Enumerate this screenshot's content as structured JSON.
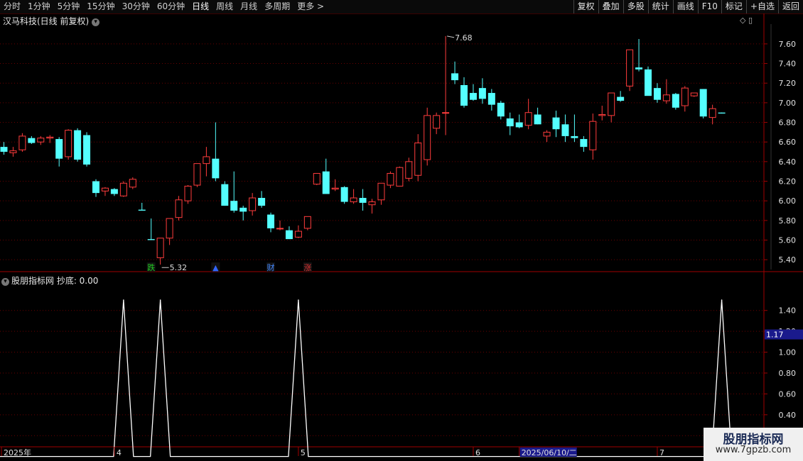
{
  "toolbar": {
    "left": [
      "分时",
      "1分钟",
      "5分钟",
      "15分钟",
      "30分钟",
      "60分钟",
      "日线",
      "周线",
      "月线",
      "多周期",
      "更多 >"
    ],
    "active": "日线",
    "right": [
      "复权",
      "叠加",
      "多股",
      "统计",
      "画线",
      "F10",
      "标记",
      "+自选",
      "返回"
    ]
  },
  "header": {
    "title": "汉马科技(日线 前复权)",
    "top_icons": "◇ ▯"
  },
  "indicator": {
    "title": "股朋指标网  抄底: 0.00",
    "value_tag": "1.17"
  },
  "watermark": {
    "line1": "股朋指标网",
    "line2": "www.7gpzb.com"
  },
  "colors": {
    "up": "#ff3c3c",
    "down": "#54ffff",
    "grid": "#6a0000",
    "axis": "#a00000",
    "line": "#ffffff"
  },
  "chart_data": [
    {
      "type": "candlestick",
      "price_axis": {
        "ylim": [
          5.3,
          7.78
        ],
        "ticks": [
          5.4,
          5.6,
          5.8,
          6.0,
          6.2,
          6.4,
          6.6,
          6.8,
          7.0,
          7.2,
          7.4,
          7.6
        ]
      },
      "annotations": [
        {
          "text": "7.68",
          "price": 7.68,
          "index": 48
        },
        {
          "text": "5.32",
          "price": 5.32,
          "index": 17
        }
      ],
      "markers": [
        {
          "text": "跌",
          "index": 16,
          "color": "#22cc22"
        },
        {
          "text": "▲",
          "index": 23,
          "color": "#3366ff"
        },
        {
          "text": "财",
          "index": 29,
          "color": "#4488ff"
        },
        {
          "text": "涨",
          "index": 33,
          "color": "#dd3333"
        }
      ],
      "candles": [
        [
          6.55,
          6.6,
          6.47,
          6.5
        ],
        [
          6.49,
          6.55,
          6.45,
          6.51
        ],
        [
          6.52,
          6.69,
          6.5,
          6.66
        ],
        [
          6.64,
          6.66,
          6.58,
          6.59
        ],
        [
          6.6,
          6.66,
          6.57,
          6.64
        ],
        [
          6.64,
          6.67,
          6.59,
          6.65
        ],
        [
          6.63,
          6.65,
          6.35,
          6.43
        ],
        [
          6.45,
          6.73,
          6.42,
          6.72
        ],
        [
          6.72,
          6.74,
          6.4,
          6.42
        ],
        [
          6.67,
          6.7,
          6.35,
          6.37
        ],
        [
          6.2,
          6.22,
          6.04,
          6.08
        ],
        [
          6.1,
          6.14,
          6.05,
          6.13
        ],
        [
          6.12,
          6.13,
          6.05,
          6.07
        ],
        [
          6.05,
          6.2,
          6.04,
          6.18
        ],
        [
          6.14,
          6.24,
          6.12,
          6.22
        ],
        [
          5.91,
          5.98,
          5.9,
          5.9
        ],
        [
          5.61,
          5.82,
          5.6,
          5.6
        ],
        [
          5.42,
          5.62,
          5.35,
          5.62
        ],
        [
          5.62,
          5.8,
          5.55,
          5.82
        ],
        [
          5.83,
          6.05,
          5.8,
          6.01
        ],
        [
          6.0,
          6.16,
          5.97,
          6.15
        ],
        [
          6.16,
          6.38,
          6.14,
          6.38
        ],
        [
          6.38,
          6.55,
          6.25,
          6.45
        ],
        [
          6.43,
          6.8,
          6.2,
          6.23
        ],
        [
          6.17,
          6.2,
          5.95,
          5.95
        ],
        [
          6.0,
          6.3,
          5.88,
          5.9
        ],
        [
          5.93,
          5.95,
          5.8,
          5.89
        ],
        [
          5.9,
          6.08,
          5.85,
          6.03
        ],
        [
          6.03,
          6.1,
          5.93,
          5.95
        ],
        [
          5.86,
          5.88,
          5.68,
          5.72
        ],
        [
          5.72,
          5.8,
          5.7,
          5.72
        ],
        [
          5.7,
          5.74,
          5.61,
          5.61
        ],
        [
          5.63,
          5.75,
          5.62,
          5.69
        ],
        [
          5.72,
          5.84,
          5.7,
          5.84
        ],
        [
          6.17,
          6.28,
          6.16,
          6.28
        ],
        [
          6.3,
          6.43,
          6.07,
          6.07
        ],
        [
          6.12,
          6.22,
          6.1,
          6.13
        ],
        [
          6.14,
          6.15,
          5.97,
          5.99
        ],
        [
          5.99,
          6.12,
          5.97,
          6.03
        ],
        [
          6.03,
          6.12,
          5.9,
          5.98
        ],
        [
          5.96,
          6.02,
          5.87,
          5.99
        ],
        [
          6.01,
          6.18,
          5.96,
          6.18
        ],
        [
          6.16,
          6.3,
          6.13,
          6.28
        ],
        [
          6.15,
          6.35,
          6.15,
          6.34
        ],
        [
          6.23,
          6.44,
          6.2,
          6.4
        ],
        [
          6.26,
          6.68,
          6.2,
          6.59
        ],
        [
          6.42,
          6.95,
          6.36,
          6.87
        ],
        [
          6.74,
          6.9,
          6.68,
          6.87
        ],
        [
          6.9,
          7.68,
          6.67,
          6.9
        ],
        [
          7.3,
          7.42,
          7.19,
          7.23
        ],
        [
          7.18,
          7.26,
          6.95,
          6.97
        ],
        [
          7.1,
          7.19,
          7.02,
          7.03
        ],
        [
          7.15,
          7.25,
          6.99,
          7.04
        ],
        [
          7.1,
          7.14,
          6.92,
          6.98
        ],
        [
          7.0,
          7.02,
          6.83,
          6.86
        ],
        [
          6.84,
          6.9,
          6.67,
          6.76
        ],
        [
          6.8,
          6.88,
          6.74,
          6.75
        ],
        [
          6.77,
          7.04,
          6.73,
          6.9
        ],
        [
          6.88,
          6.95,
          6.78,
          6.78
        ],
        [
          6.66,
          6.72,
          6.6,
          6.7
        ],
        [
          6.85,
          6.92,
          6.65,
          6.73
        ],
        [
          6.78,
          6.88,
          6.6,
          6.66
        ],
        [
          6.66,
          6.88,
          6.6,
          6.64
        ],
        [
          6.63,
          6.66,
          6.5,
          6.55
        ],
        [
          6.52,
          6.89,
          6.42,
          6.81
        ],
        [
          6.87,
          6.97,
          6.82,
          6.88
        ],
        [
          6.87,
          7.1,
          6.8,
          7.1
        ],
        [
          7.06,
          7.12,
          7.01,
          7.02
        ],
        [
          7.17,
          7.54,
          7.12,
          7.54
        ],
        [
          7.36,
          7.65,
          7.32,
          7.34
        ],
        [
          7.34,
          7.37,
          7.08,
          7.07
        ],
        [
          7.15,
          7.2,
          7.0,
          7.03
        ],
        [
          7.02,
          7.24,
          6.99,
          7.08
        ],
        [
          7.09,
          7.1,
          6.93,
          6.95
        ],
        [
          6.97,
          7.17,
          6.91,
          7.15
        ],
        [
          7.07,
          7.1,
          7.06,
          7.1
        ],
        [
          7.14,
          7.14,
          6.84,
          6.86
        ],
        [
          6.85,
          6.98,
          6.78,
          6.94
        ],
        [
          6.9,
          6.9,
          6.89,
          6.89
        ]
      ]
    },
    {
      "type": "line",
      "name": "抄底",
      "ylim": [
        0.12,
        1.67
      ],
      "ticks": [
        0.2,
        0.4,
        0.6,
        0.8,
        1.0,
        1.2,
        1.4
      ],
      "baseline": 0,
      "spikes": [
        {
          "index": 13,
          "value": 1.5
        },
        {
          "index": 17,
          "value": 1.5
        },
        {
          "index": 32,
          "value": 1.5
        },
        {
          "index": 78,
          "value": 1.5
        }
      ]
    }
  ],
  "time_axis": [
    {
      "label": "2025年",
      "index": 0
    },
    {
      "label": "4",
      "index": 12
    },
    {
      "label": "5",
      "index": 32
    },
    {
      "label": "6",
      "index": 51
    },
    {
      "label": "2025/06/10/二",
      "index": 56,
      "highlight": true
    },
    {
      "label": "7",
      "index": 71
    }
  ]
}
